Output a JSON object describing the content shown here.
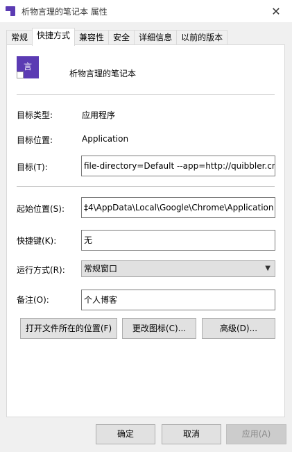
{
  "window": {
    "title": "析物言理的笔记本 属性"
  },
  "tabs": [
    {
      "label": "常规"
    },
    {
      "label": "快捷方式"
    },
    {
      "label": "兼容性"
    },
    {
      "label": "安全"
    },
    {
      "label": "详细信息"
    },
    {
      "label": "以前的版本"
    }
  ],
  "app": {
    "name": "析物言理的笔记本",
    "icon_glyph": "言",
    "icon_color": "#5b3bb3"
  },
  "fields": {
    "target_type": {
      "label": "目标类型:",
      "value": "应用程序"
    },
    "target_location": {
      "label": "目标位置:",
      "value": "Application"
    },
    "target": {
      "label": "目标(T):",
      "value": "file-directory=Default --app=http://quibbler.cn"
    },
    "start_in": {
      "label": "起始位置(S):",
      "value": "‡4\\AppData\\Local\\Google\\Chrome\\Application"
    },
    "shortcut_key": {
      "label": "快捷键(K):",
      "value": "无"
    },
    "run": {
      "label": "运行方式(R):",
      "value": "常规窗口"
    },
    "comment": {
      "label": "备注(O):",
      "value": "个人博客"
    }
  },
  "buttons": {
    "open_location": "打开文件所在的位置(F)",
    "change_icon": "更改图标(C)...",
    "advanced": "高级(D)...",
    "ok": "确定",
    "cancel": "取消",
    "apply": "应用(A)"
  }
}
